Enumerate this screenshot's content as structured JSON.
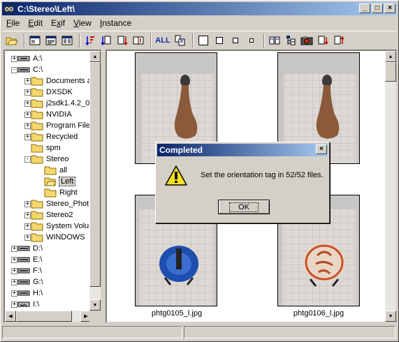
{
  "window": {
    "title": "C:\\Stereo\\Left\\"
  },
  "titlebar": {
    "minimize_glyph": "_",
    "maximize_glyph": "□",
    "close_glyph": "×"
  },
  "menu": {
    "file": {
      "key": "F",
      "rest": "ile"
    },
    "edit": {
      "key": "E",
      "rest": "dit"
    },
    "exif": {
      "pre": "E",
      "key": "x",
      "rest": "if"
    },
    "view": {
      "key": "V",
      "rest": "iew"
    },
    "instance": {
      "key": "I",
      "rest": "nstance"
    }
  },
  "toolbar": {
    "all_label": "ALL"
  },
  "tree": {
    "items": [
      {
        "label": "A:\\",
        "kind": "drive-floppy"
      },
      {
        "label": "C:\\",
        "kind": "drive"
      },
      {
        "label": "Documents a",
        "kind": "folder"
      },
      {
        "label": "DXSDK",
        "kind": "folder"
      },
      {
        "label": "j2sdk1.4.2_0",
        "kind": "folder"
      },
      {
        "label": "NVIDIA",
        "kind": "folder"
      },
      {
        "label": "Program File",
        "kind": "folder"
      },
      {
        "label": "Recycled",
        "kind": "folder"
      },
      {
        "label": "spm",
        "kind": "folder"
      },
      {
        "label": "Stereo",
        "kind": "folder"
      },
      {
        "label": "all",
        "kind": "folder"
      },
      {
        "label": "Left",
        "kind": "folder-open"
      },
      {
        "label": "Right",
        "kind": "folder"
      },
      {
        "label": "Stereo_Phot",
        "kind": "folder"
      },
      {
        "label": "Stereo2",
        "kind": "folder"
      },
      {
        "label": "System Volur",
        "kind": "folder"
      },
      {
        "label": "WINDOWS",
        "kind": "folder"
      },
      {
        "label": "D:\\",
        "kind": "drive"
      },
      {
        "label": "E:\\",
        "kind": "drive"
      },
      {
        "label": "F:\\",
        "kind": "drive"
      },
      {
        "label": "G:\\",
        "kind": "drive"
      },
      {
        "label": "H:\\",
        "kind": "drive"
      },
      {
        "label": "I:\\",
        "kind": "drive-net"
      }
    ]
  },
  "thumbnails": {
    "captions": {
      "row1_left": "pht",
      "row1_right": ".jpg",
      "row2_left": "phtg0105_l.jpg",
      "row2_right": "phtg0106_l.jpg"
    }
  },
  "dialog": {
    "title": "Completed",
    "message": "Set the orientation tag in 52/52 files.",
    "ok_label": "OK",
    "close_glyph": "×"
  },
  "colors": {
    "title_start": "#0a246a",
    "title_end": "#a6caf0",
    "face": "#d4d0c8",
    "folder": "#f5d76e"
  }
}
